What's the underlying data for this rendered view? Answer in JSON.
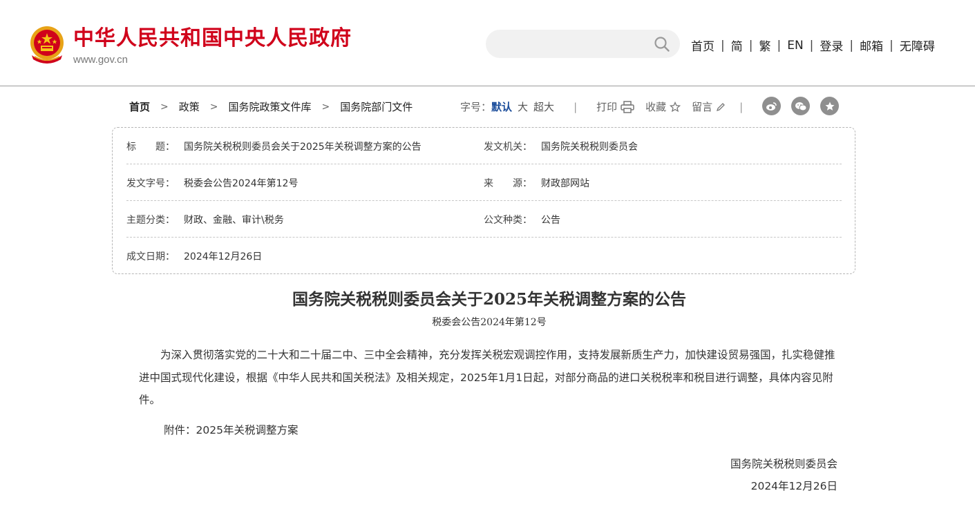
{
  "header": {
    "site_name": "中华人民共和国中央人民政府",
    "site_url": "www.gov.cn",
    "search_placeholder": "",
    "nav": [
      {
        "label": "首页"
      },
      {
        "label": "简"
      },
      {
        "label": "繁"
      },
      {
        "label": "EN"
      },
      {
        "label": "登录"
      },
      {
        "label": "邮箱"
      },
      {
        "label": "无障碍"
      }
    ],
    "nav_separator": "|"
  },
  "breadcrumb": {
    "items": [
      "首页",
      "政策",
      "国务院政策文件库",
      "国务院部门文件"
    ],
    "separator": ">"
  },
  "tools": {
    "font_size_label": "字号：",
    "font_size_options": [
      "默认",
      "大",
      "超大"
    ],
    "print_label": "打印",
    "favorite_label": "收藏",
    "comment_label": "留言",
    "separator": "|"
  },
  "share": {
    "icons": [
      "weibo-icon",
      "wechat-icon",
      "star-share-icon"
    ]
  },
  "info": {
    "rows": [
      {
        "l_label": "标　　题：",
        "l_value": "国务院关税税则委员会关于2025年关税调整方案的公告",
        "r_label": "发文机关：",
        "r_value": "国务院关税税则委员会"
      },
      {
        "l_label": "发文字号：",
        "l_value": "税委会公告2024年第12号",
        "r_label": "来　　源：",
        "r_value": "财政部网站"
      },
      {
        "l_label": "主题分类：",
        "l_value": "财政、金融、审计\\税务",
        "r_label": "公文种类：",
        "r_value": "公告"
      },
      {
        "l_label": "成文日期：",
        "l_value": "2024年12月26日"
      }
    ]
  },
  "article": {
    "title": "国务院关税税则委员会关于2025年关税调整方案的公告",
    "doc_number": "税委会公告2024年第12号",
    "paragraph": "为深入贯彻落实党的二十大和二十届二中、三中全会精神，充分发挥关税宏观调控作用，支持发展新质生产力，加快建设贸易强国，扎实稳健推进中国式现代化建设，根据《中华人民共和国关税法》及相关规定，2025年1月1日起，对部分商品的进口关税税率和税目进行调整，具体内容见附件。",
    "attachment": "附件：2025年关税调整方案",
    "signature_org": "国务院关税税则委员会",
    "signature_date": "2024年12月26日"
  },
  "colors": {
    "brand_red": "#d0021b",
    "active_blue": "#1b4d9b",
    "share_gray": "#8f8f8f"
  }
}
